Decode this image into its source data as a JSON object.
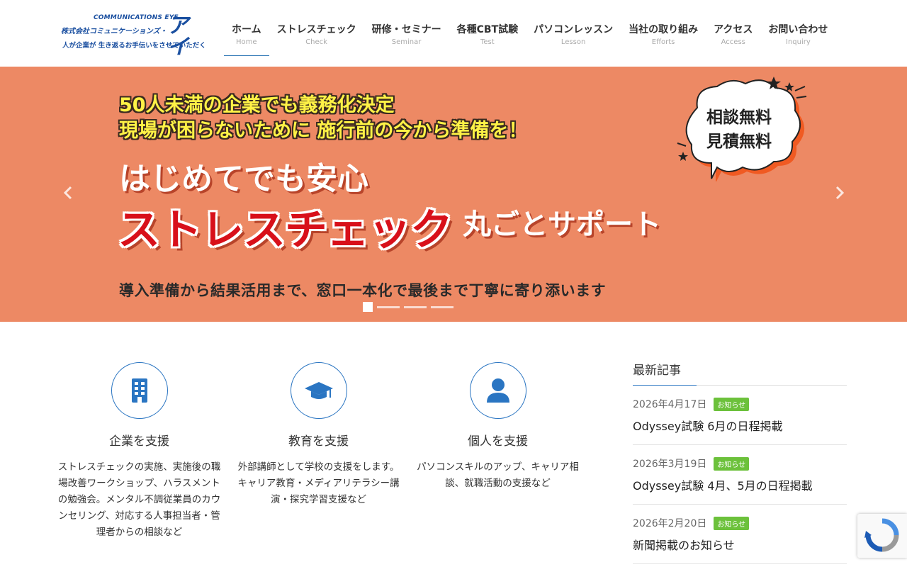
{
  "logo": {
    "en": "COMMUNICATIONS EYE",
    "company": "株式会社コミュニケーションズ・",
    "mark": "アイ",
    "tagline": "人が企業が 生き返るお手伝いをさせていただく"
  },
  "nav": [
    {
      "jp": "ホーム",
      "en": "Home",
      "active": true
    },
    {
      "jp": "ストレスチェック",
      "en": "Check"
    },
    {
      "jp": "研修・セミナー",
      "en": "Seminar"
    },
    {
      "jp": "各種CBT試験",
      "en": "Test"
    },
    {
      "jp": "パソコンレッスン",
      "en": "Lesson"
    },
    {
      "jp": "当社の取り組み",
      "en": "Efforts"
    },
    {
      "jp": "アクセス",
      "en": "Access"
    },
    {
      "jp": "お問い合わせ",
      "en": "Inquiry"
    }
  ],
  "hero": {
    "line1": "50人未満の企業でも義務化決定",
    "line2": "現場が困らないために 施行前の今から準備を！",
    "line3": "はじめてでも安心",
    "line4": "ストレスチェック",
    "line5": "丸ごとサポート",
    "line6": "導入準備から結果活用まで、窓口一本化で最後まで丁寧に寄り添います",
    "bubble": {
      "line1": "相談無料",
      "line2": "見積無料"
    },
    "bg_color": "#ed8964"
  },
  "features": [
    {
      "icon": "building-icon",
      "title": "企業を支援",
      "desc": "ストレスチェックの実施、実施後の職場改善ワークショップ、ハラスメントの勉強会。メンタル不調従業員のカウンセリング、対応する人事担当者・管理者からの相談など"
    },
    {
      "icon": "graduation-cap-icon",
      "title": "教育を支援",
      "desc": "外部講師として学校の支援をします。キャリア教育・メディアリテラシー講演・探究学習支援など"
    },
    {
      "icon": "person-icon",
      "title": "個人を支援",
      "desc": "パソコンスキルのアップ、キャリア相談、就職活動の支援など"
    }
  ],
  "sidebar": {
    "heading": "最新記事",
    "posts": [
      {
        "date": "2026年4月17日",
        "badge": "お知らせ",
        "title": "Odyssey試験 6月の日程掲載"
      },
      {
        "date": "2026年3月19日",
        "badge": "お知らせ",
        "title": "Odyssey試験 4月、5月の日程掲載"
      },
      {
        "date": "2026年2月20日",
        "badge": "お知らせ",
        "title": "新聞掲載のお知らせ"
      }
    ]
  },
  "colors": {
    "accent": "#2a75c2",
    "badge": "#6cc13b"
  }
}
